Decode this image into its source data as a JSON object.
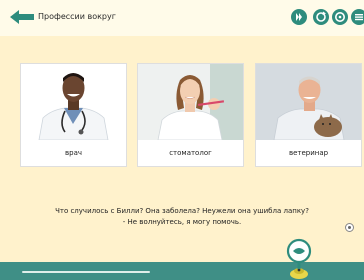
{
  "header": {
    "title": "Профессии вокруг",
    "buttons": [
      "play-icon",
      "refresh-icon",
      "settings-icon",
      "menu-icon"
    ]
  },
  "cards": [
    {
      "label": "врач"
    },
    {
      "label": "стоматолог"
    },
    {
      "label": "ветеринар"
    }
  ],
  "dialog": {
    "line1": "Что случилось с Билли? Она заболела? Неужели она ушибла лапку?",
    "line2": "- Не волнуйтесь, я могу помочь."
  },
  "colors": {
    "accent": "#2e8c7d",
    "background": "#fff2cc",
    "bottom_bar": "#3f8f86"
  }
}
